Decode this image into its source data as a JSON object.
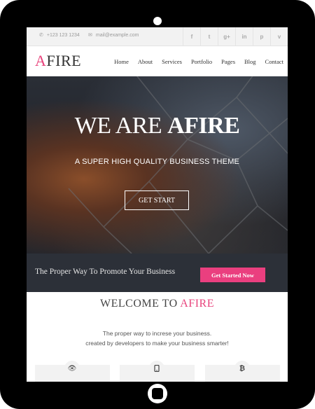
{
  "topbar": {
    "phone": "+123 123 1234",
    "email": "mail@example.com",
    "social": [
      "f",
      "t",
      "g+",
      "in",
      "p",
      "v"
    ]
  },
  "nav": {
    "logo_accent": "A",
    "logo_rest": "FIRE",
    "items": [
      "Home",
      "About",
      "Services",
      "Portfolio",
      "Pages",
      "Blog",
      "Contact"
    ]
  },
  "hero": {
    "title_light": "WE ARE ",
    "title_bold": "AFIRE",
    "subtitle": "A SUPER HIGH QUALITY BUSINESS THEME",
    "button": "GET START"
  },
  "promo": {
    "text": "The Proper Way To Promote Your Business",
    "button": "Get Started Now"
  },
  "welcome": {
    "title_plain": "WELCOME TO ",
    "title_accent": "AFIRE",
    "line1": "The proper way to increse your business.",
    "line2": "created by developers to make your business smarter!"
  },
  "features": [
    {
      "icon": "eye-icon",
      "glyph": "👁"
    },
    {
      "icon": "tablet-icon",
      "glyph": "▯"
    },
    {
      "icon": "bitcoin-icon",
      "glyph": "₿"
    }
  ],
  "colors": {
    "accent": "#e8437c",
    "promo_bg": "#2c3038",
    "frame": "#000000"
  }
}
